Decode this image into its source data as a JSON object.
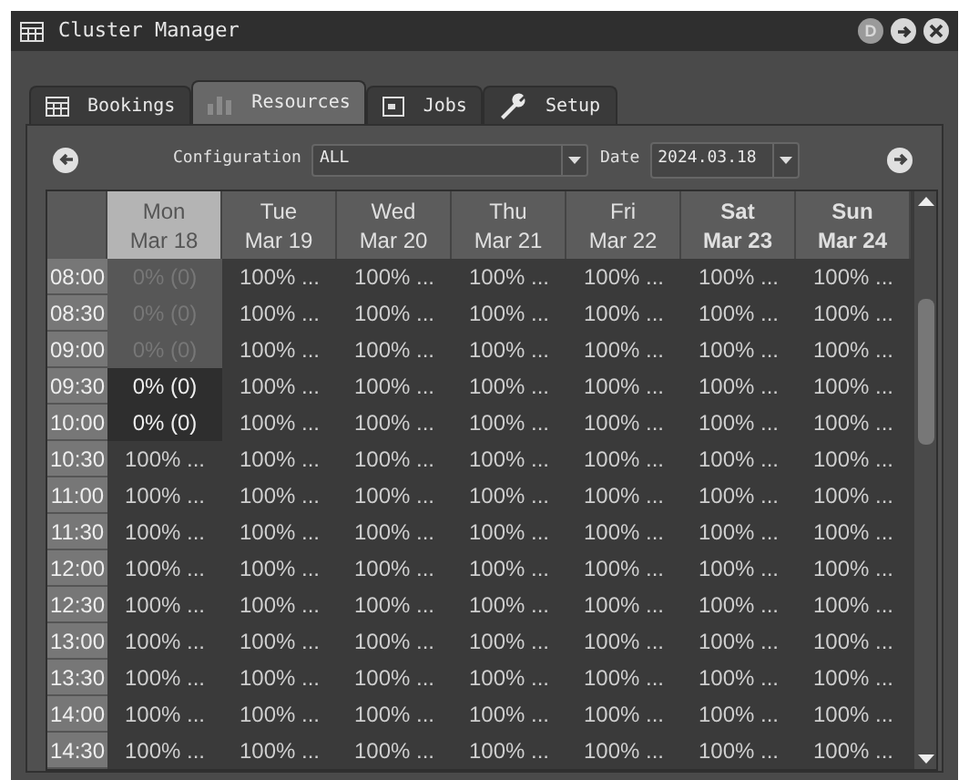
{
  "window": {
    "title": "Cluster Manager",
    "first_button_label": "D"
  },
  "tabs": [
    {
      "label": "Bookings",
      "selected": false
    },
    {
      "label": "Resources",
      "selected": true
    },
    {
      "label": "Jobs",
      "selected": false
    },
    {
      "label": "Setup",
      "selected": false
    }
  ],
  "toolbar": {
    "configuration_label": "Configuration",
    "configuration_value": "ALL",
    "date_label": "Date",
    "date_value": "2024.03.18"
  },
  "table": {
    "columns": [
      {
        "day": "Mon",
        "date": "Mar 18",
        "selected": true,
        "weekend": false
      },
      {
        "day": "Tue",
        "date": "Mar 19",
        "selected": false,
        "weekend": false
      },
      {
        "day": "Wed",
        "date": "Mar 20",
        "selected": false,
        "weekend": false
      },
      {
        "day": "Thu",
        "date": "Mar 21",
        "selected": false,
        "weekend": false
      },
      {
        "day": "Fri",
        "date": "Mar 22",
        "selected": false,
        "weekend": false
      },
      {
        "day": "Sat",
        "date": "Mar 23",
        "selected": false,
        "weekend": true
      },
      {
        "day": "Sun",
        "date": "Mar 24",
        "selected": false,
        "weekend": true
      }
    ],
    "rows": [
      {
        "time": "08:00",
        "cells": [
          {
            "text": "0% (0)",
            "kind": "past"
          },
          {
            "text": "100% ...",
            "kind": "booked"
          },
          {
            "text": "100% ...",
            "kind": "booked"
          },
          {
            "text": "100% ...",
            "kind": "booked"
          },
          {
            "text": "100% ...",
            "kind": "booked"
          },
          {
            "text": "100% ...",
            "kind": "booked"
          },
          {
            "text": "100% ...",
            "kind": "booked"
          }
        ]
      },
      {
        "time": "08:30",
        "cells": [
          {
            "text": "0% (0)",
            "kind": "past"
          },
          {
            "text": "100% ...",
            "kind": "booked"
          },
          {
            "text": "100% ...",
            "kind": "booked"
          },
          {
            "text": "100% ...",
            "kind": "booked"
          },
          {
            "text": "100% ...",
            "kind": "booked"
          },
          {
            "text": "100% ...",
            "kind": "booked"
          },
          {
            "text": "100% ...",
            "kind": "booked"
          }
        ]
      },
      {
        "time": "09:00",
        "cells": [
          {
            "text": "0% (0)",
            "kind": "past"
          },
          {
            "text": "100% ...",
            "kind": "booked"
          },
          {
            "text": "100% ...",
            "kind": "booked"
          },
          {
            "text": "100% ...",
            "kind": "booked"
          },
          {
            "text": "100% ...",
            "kind": "booked"
          },
          {
            "text": "100% ...",
            "kind": "booked"
          },
          {
            "text": "100% ...",
            "kind": "booked"
          }
        ]
      },
      {
        "time": "09:30",
        "cells": [
          {
            "text": "0% (0)",
            "kind": "free"
          },
          {
            "text": "100% ...",
            "kind": "booked"
          },
          {
            "text": "100% ...",
            "kind": "booked"
          },
          {
            "text": "100% ...",
            "kind": "booked"
          },
          {
            "text": "100% ...",
            "kind": "booked"
          },
          {
            "text": "100% ...",
            "kind": "booked"
          },
          {
            "text": "100% ...",
            "kind": "booked"
          }
        ]
      },
      {
        "time": "10:00",
        "cells": [
          {
            "text": "0% (0)",
            "kind": "free"
          },
          {
            "text": "100% ...",
            "kind": "booked"
          },
          {
            "text": "100% ...",
            "kind": "booked"
          },
          {
            "text": "100% ...",
            "kind": "booked"
          },
          {
            "text": "100% ...",
            "kind": "booked"
          },
          {
            "text": "100% ...",
            "kind": "booked"
          },
          {
            "text": "100% ...",
            "kind": "booked"
          }
        ]
      },
      {
        "time": "10:30",
        "cells": [
          {
            "text": "100% ...",
            "kind": "booked"
          },
          {
            "text": "100% ...",
            "kind": "booked"
          },
          {
            "text": "100% ...",
            "kind": "booked"
          },
          {
            "text": "100% ...",
            "kind": "booked"
          },
          {
            "text": "100% ...",
            "kind": "booked"
          },
          {
            "text": "100% ...",
            "kind": "booked"
          },
          {
            "text": "100% ...",
            "kind": "booked"
          }
        ]
      },
      {
        "time": "11:00",
        "cells": [
          {
            "text": "100% ...",
            "kind": "booked"
          },
          {
            "text": "100% ...",
            "kind": "booked"
          },
          {
            "text": "100% ...",
            "kind": "booked"
          },
          {
            "text": "100% ...",
            "kind": "booked"
          },
          {
            "text": "100% ...",
            "kind": "booked"
          },
          {
            "text": "100% ...",
            "kind": "booked"
          },
          {
            "text": "100% ...",
            "kind": "booked"
          }
        ]
      },
      {
        "time": "11:30",
        "cells": [
          {
            "text": "100% ...",
            "kind": "booked"
          },
          {
            "text": "100% ...",
            "kind": "booked"
          },
          {
            "text": "100% ...",
            "kind": "booked"
          },
          {
            "text": "100% ...",
            "kind": "booked"
          },
          {
            "text": "100% ...",
            "kind": "booked"
          },
          {
            "text": "100% ...",
            "kind": "booked"
          },
          {
            "text": "100% ...",
            "kind": "booked"
          }
        ]
      },
      {
        "time": "12:00",
        "cells": [
          {
            "text": "100% ...",
            "kind": "booked"
          },
          {
            "text": "100% ...",
            "kind": "booked"
          },
          {
            "text": "100% ...",
            "kind": "booked"
          },
          {
            "text": "100% ...",
            "kind": "booked"
          },
          {
            "text": "100% ...",
            "kind": "booked"
          },
          {
            "text": "100% ...",
            "kind": "booked"
          },
          {
            "text": "100% ...",
            "kind": "booked"
          }
        ]
      },
      {
        "time": "12:30",
        "cells": [
          {
            "text": "100% ...",
            "kind": "booked"
          },
          {
            "text": "100% ...",
            "kind": "booked"
          },
          {
            "text": "100% ...",
            "kind": "booked"
          },
          {
            "text": "100% ...",
            "kind": "booked"
          },
          {
            "text": "100% ...",
            "kind": "booked"
          },
          {
            "text": "100% ...",
            "kind": "booked"
          },
          {
            "text": "100% ...",
            "kind": "booked"
          }
        ]
      },
      {
        "time": "13:00",
        "cells": [
          {
            "text": "100% ...",
            "kind": "booked"
          },
          {
            "text": "100% ...",
            "kind": "booked"
          },
          {
            "text": "100% ...",
            "kind": "booked"
          },
          {
            "text": "100% ...",
            "kind": "booked"
          },
          {
            "text": "100% ...",
            "kind": "booked"
          },
          {
            "text": "100% ...",
            "kind": "booked"
          },
          {
            "text": "100% ...",
            "kind": "booked"
          }
        ]
      },
      {
        "time": "13:30",
        "cells": [
          {
            "text": "100% ...",
            "kind": "booked"
          },
          {
            "text": "100% ...",
            "kind": "booked"
          },
          {
            "text": "100% ...",
            "kind": "booked"
          },
          {
            "text": "100% ...",
            "kind": "booked"
          },
          {
            "text": "100% ...",
            "kind": "booked"
          },
          {
            "text": "100% ...",
            "kind": "booked"
          },
          {
            "text": "100% ...",
            "kind": "booked"
          }
        ]
      },
      {
        "time": "14:00",
        "cells": [
          {
            "text": "100% ...",
            "kind": "booked"
          },
          {
            "text": "100% ...",
            "kind": "booked"
          },
          {
            "text": "100% ...",
            "kind": "booked"
          },
          {
            "text": "100% ...",
            "kind": "booked"
          },
          {
            "text": "100% ...",
            "kind": "booked"
          },
          {
            "text": "100% ...",
            "kind": "booked"
          },
          {
            "text": "100% ...",
            "kind": "booked"
          }
        ]
      },
      {
        "time": "14:30",
        "cells": [
          {
            "text": "100% ...",
            "kind": "booked"
          },
          {
            "text": "100% ...",
            "kind": "booked"
          },
          {
            "text": "100% ...",
            "kind": "booked"
          },
          {
            "text": "100% ...",
            "kind": "booked"
          },
          {
            "text": "100% ...",
            "kind": "booked"
          },
          {
            "text": "100% ...",
            "kind": "booked"
          },
          {
            "text": "100% ...",
            "kind": "booked"
          }
        ]
      }
    ]
  }
}
